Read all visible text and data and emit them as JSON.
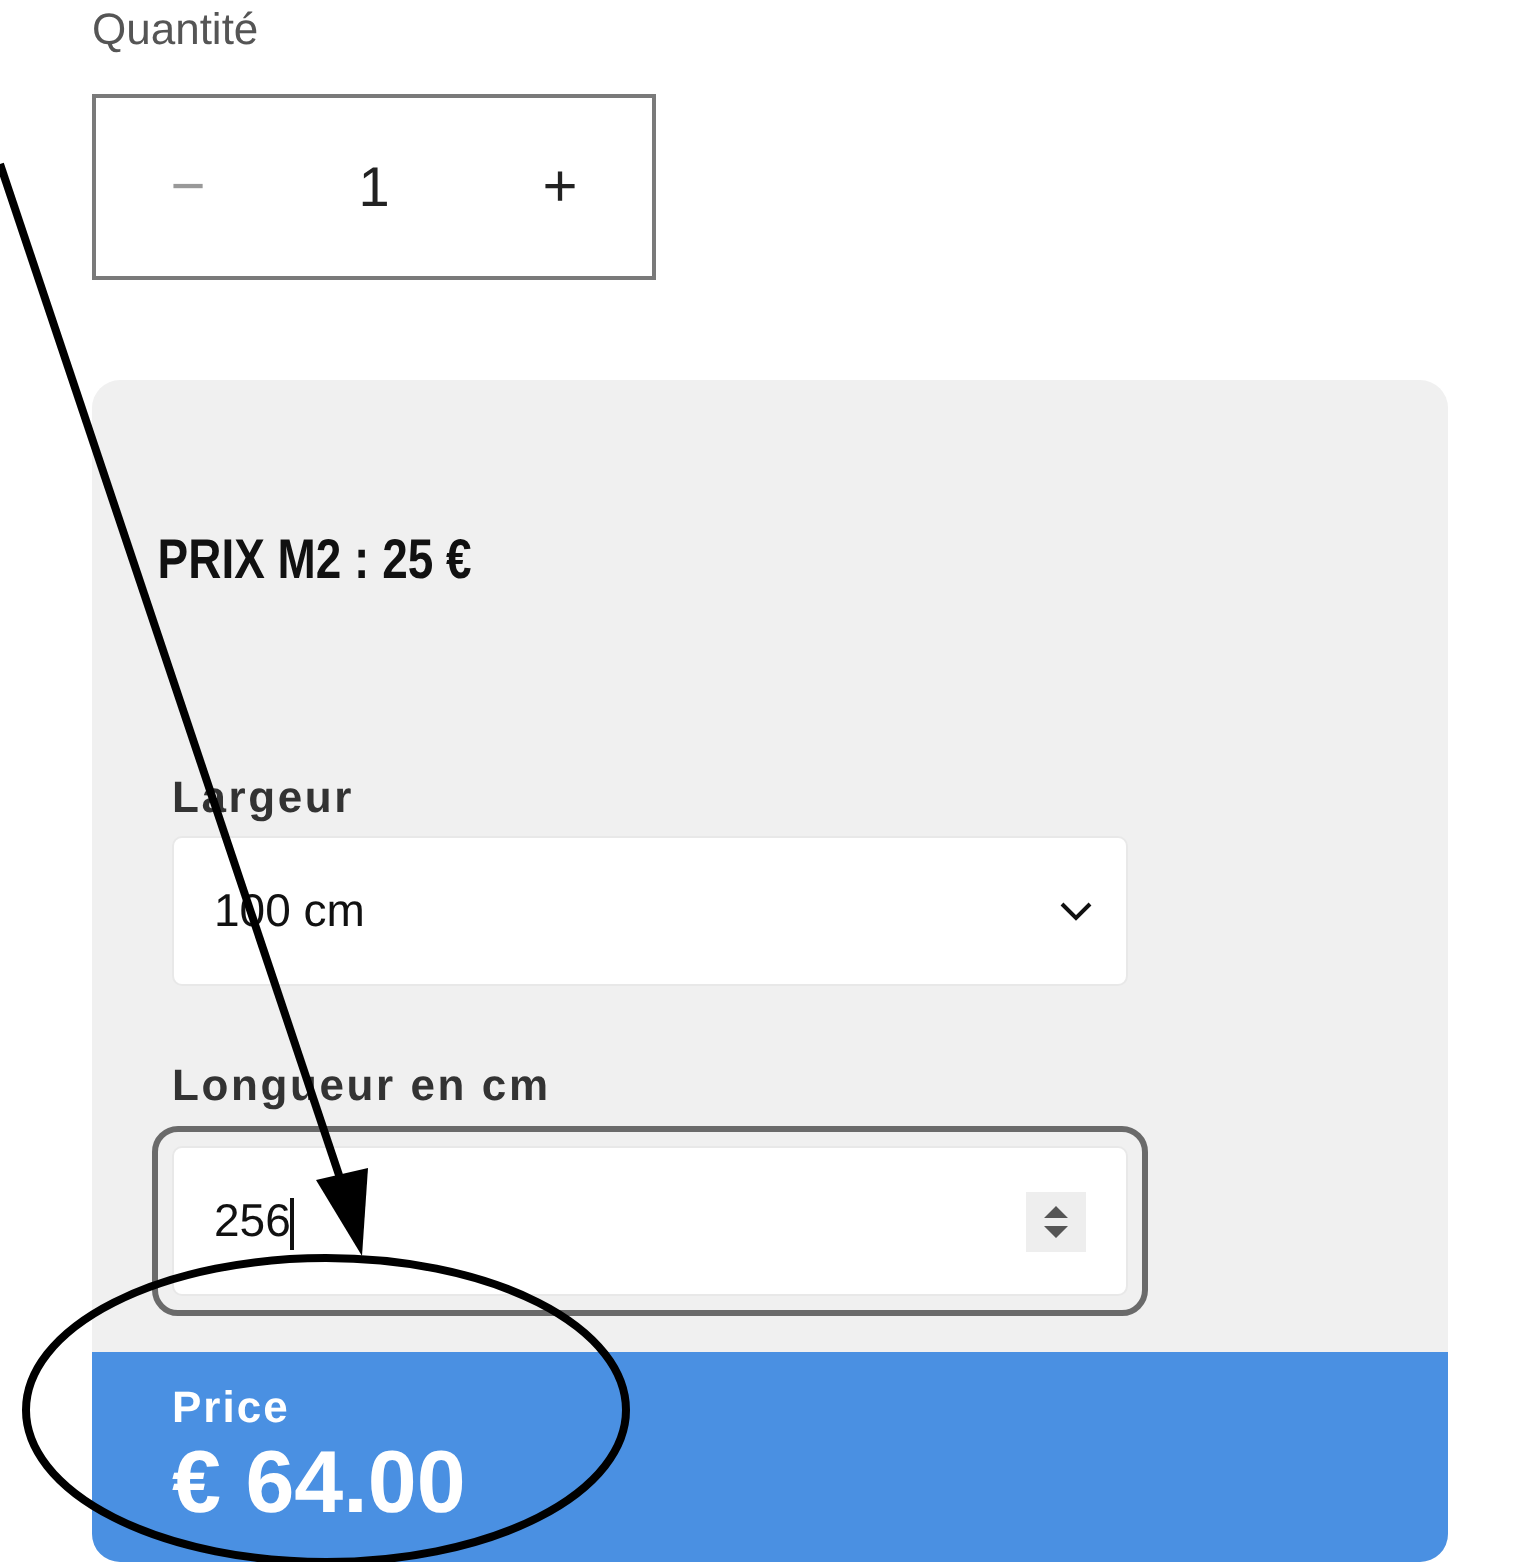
{
  "quantity": {
    "label": "Quantité",
    "minus": "−",
    "value": "1",
    "plus": "+",
    "minus_disabled": true
  },
  "panel": {
    "title": "PRIX M2 : 25 €",
    "fields": [
      {
        "kind": "select",
        "label": "Largeur",
        "value": "100 cm",
        "focused": false
      },
      {
        "kind": "number",
        "label": "Longueur en cm",
        "value": "256",
        "focused": true
      }
    ],
    "price": {
      "label": "Price",
      "value": "€ 64.00"
    }
  }
}
